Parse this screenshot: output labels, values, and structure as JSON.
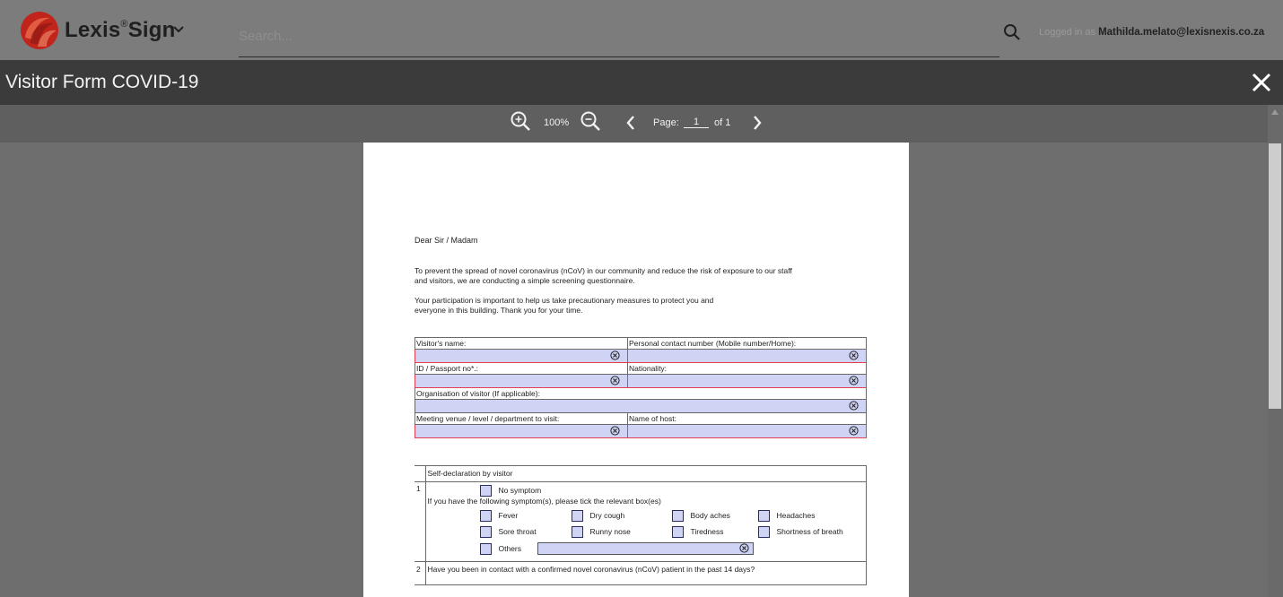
{
  "app": {
    "brand_name": "Lexis",
    "brand_mark": "®",
    "brand_suffix": "Sign",
    "search_placeholder": "Search...",
    "login_prefix": "Logged in as",
    "login_user": "Mathilda.melato@lexisnexis.co.za"
  },
  "window": {
    "title": "Visitor Form COVID-19"
  },
  "viewer": {
    "zoom": "100%",
    "page_label": "Page:",
    "page_current": "1",
    "page_total_label": "of 1"
  },
  "document": {
    "greeting": "Dear Sir / Madam",
    "para1_line1": "To prevent the spread of novel coronavirus (nCoV) in our community and reduce the risk of exposure to our staff",
    "para1_line2": "and visitors, we are conducting a simple screening questionnaire.",
    "para2_line1": "Your participation is important to help us take precautionary measures to protect you and",
    "para2_line2": "everyone in this building. Thank you for your time.",
    "fields": {
      "visitor_name": "Visitor's name:",
      "contact_number": "Personal contact number (Mobile number/Home):",
      "id_passport": "ID / Passport no*.:",
      "nationality": "Nationality:",
      "organisation": "Organisation of visitor (If applicable):",
      "meeting_venue": "Meeting venue / level / department to visit:",
      "host_name": "Name of host:"
    },
    "declaration": {
      "header": "Self-declaration by visitor",
      "q1_number": "1",
      "no_symptom": "No symptom",
      "symptom_prompt": "If you have the following symptom(s), please tick the relevant box(es)",
      "symptoms": [
        "Fever",
        "Dry cough",
        "Body aches",
        "Headaches",
        "Sore throat",
        "Runny nose",
        "Tiredness",
        "Shortness of breath"
      ],
      "others": "Others",
      "q2_number": "2",
      "q2_text": "Have you been in contact with a confirmed novel coronavirus (nCoV) patient in the past 14 days?"
    }
  },
  "colors": {
    "field_fill": "#cfd3f4",
    "required_border": "#e04050",
    "brand_red": "#c0241b"
  }
}
